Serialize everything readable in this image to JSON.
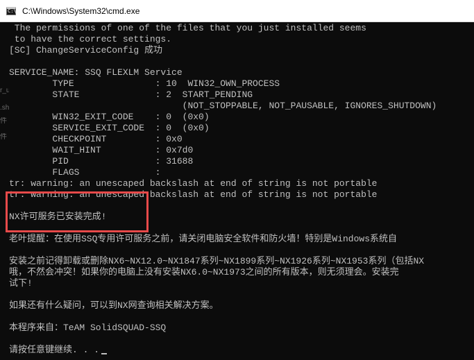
{
  "window": {
    "title": "C:\\Windows\\System32\\cmd.exe"
  },
  "console": {
    "lines": [
      " The permissions of one of the files that you just installed seems",
      " to have the correct settings.",
      "[SC] ChangeServiceConfig 成功",
      "",
      "SERVICE_NAME: SSQ FLEXLM Service",
      "        TYPE               : 10  WIN32_OWN_PROCESS",
      "        STATE              : 2  START_PENDING",
      "                                (NOT_STOPPABLE, NOT_PAUSABLE, IGNORES_SHUTDOWN)",
      "        WIN32_EXIT_CODE    : 0  (0x0)",
      "        SERVICE_EXIT_CODE  : 0  (0x0)",
      "        CHECKPOINT         : 0x0",
      "        WAIT_HINT          : 0x7d0",
      "        PID                : 31688",
      "        FLAGS              :",
      "tr: warning: an unescaped backslash at end of string is not portable",
      "tr: warning: an unescaped backslash at end of string is not portable",
      "",
      "NX许可服务已安装完成!",
      "",
      "老叶提醒：在使用SSQ专用许可服务之前，请关闭电脑安全软件和防火墙！特别是Windows系统自",
      "",
      "安装之前记得卸载或删除NX6~NX12.0~NX1847系列~NX1899系列~NX1926系列~NX1953系列（包括NX",
      "哦，不然会冲突！如果你的电脑上没有安装NX6.0~NX1973之间的所有版本，则无须理会。安装完",
      "试下!",
      "",
      "如果还有什么疑问，可以到NX网查询相关解决方案。",
      "",
      "本程序来自：TeAM SolidSQUAD-SSQ",
      "",
      "请按任意键继续. . ."
    ]
  }
}
